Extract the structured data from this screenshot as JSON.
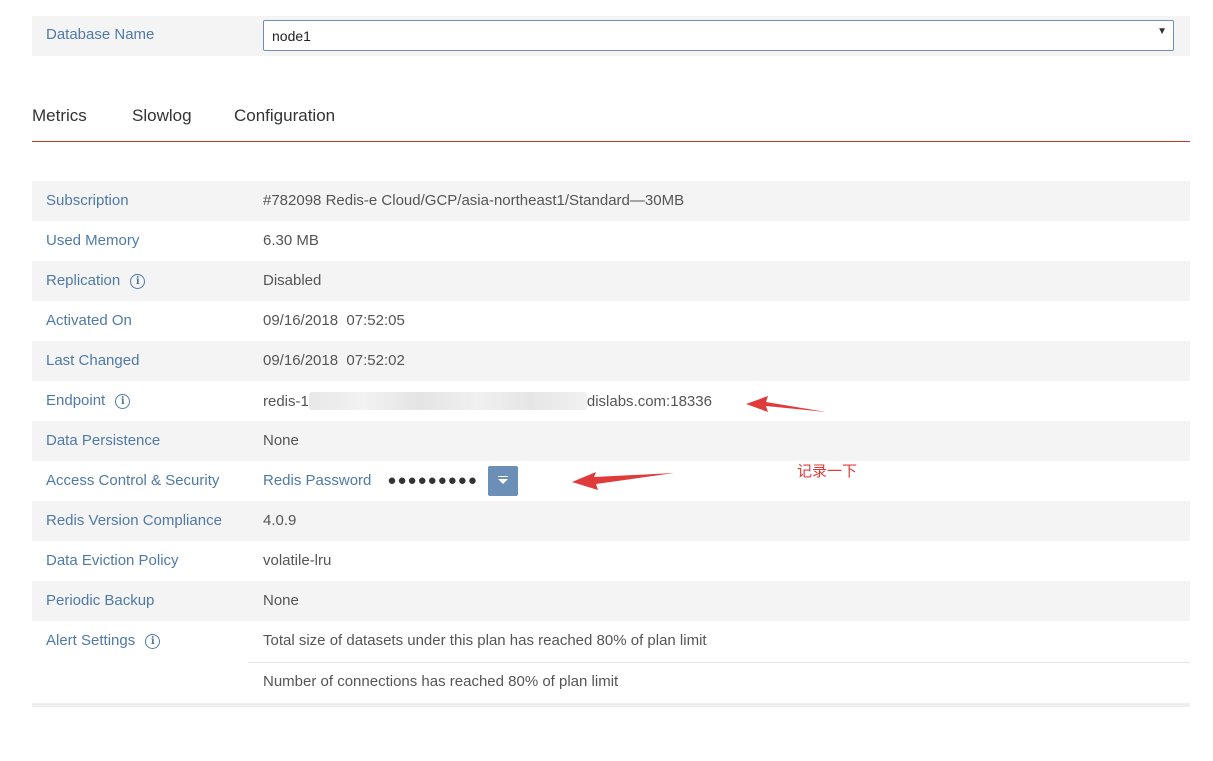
{
  "database": {
    "label": "Database Name",
    "selected": "node1"
  },
  "tabs": [
    "Metrics",
    "Slowlog",
    "Configuration"
  ],
  "details": {
    "subscription": {
      "label": "Subscription",
      "value": "#782098 Redis-e Cloud/GCP/asia-northeast1/Standard—30MB"
    },
    "used_memory": {
      "label": "Used Memory",
      "value": "6.30 MB"
    },
    "replication": {
      "label": "Replication",
      "value": "Disabled"
    },
    "activated_on": {
      "label": "Activated On",
      "value": "09/16/2018  07:52:05"
    },
    "last_changed": {
      "label": "Last Changed",
      "value": "09/16/2018  07:52:02"
    },
    "endpoint": {
      "label": "Endpoint",
      "prefix": "redis-1",
      "suffix": "dislabs.com:18336"
    },
    "data_persistence": {
      "label": "Data Persistence",
      "value": "None"
    },
    "access_control": {
      "label": "Access Control & Security",
      "password_label": "Redis Password",
      "password_mask": "●●●●●●●●●"
    },
    "redis_version": {
      "label": "Redis Version Compliance",
      "value": "4.0.9"
    },
    "eviction": {
      "label": "Data Eviction Policy",
      "value": "volatile-lru"
    },
    "backup": {
      "label": "Periodic Backup",
      "value": "None"
    },
    "alert_settings": {
      "label": "Alert Settings",
      "values": [
        "Total size of datasets under this plan has reached 80% of plan limit",
        "Number of connections has reached 80% of plan limit"
      ]
    }
  },
  "annotation": {
    "note": "记录一下"
  },
  "colors": {
    "label": "#4f7aa6",
    "tab_underline": "#c0392b",
    "annotation": "#e03b3b",
    "button": "#6b8fb7"
  },
  "icons": {
    "info": "info-icon",
    "dropdown": "chevron-down-icon"
  }
}
